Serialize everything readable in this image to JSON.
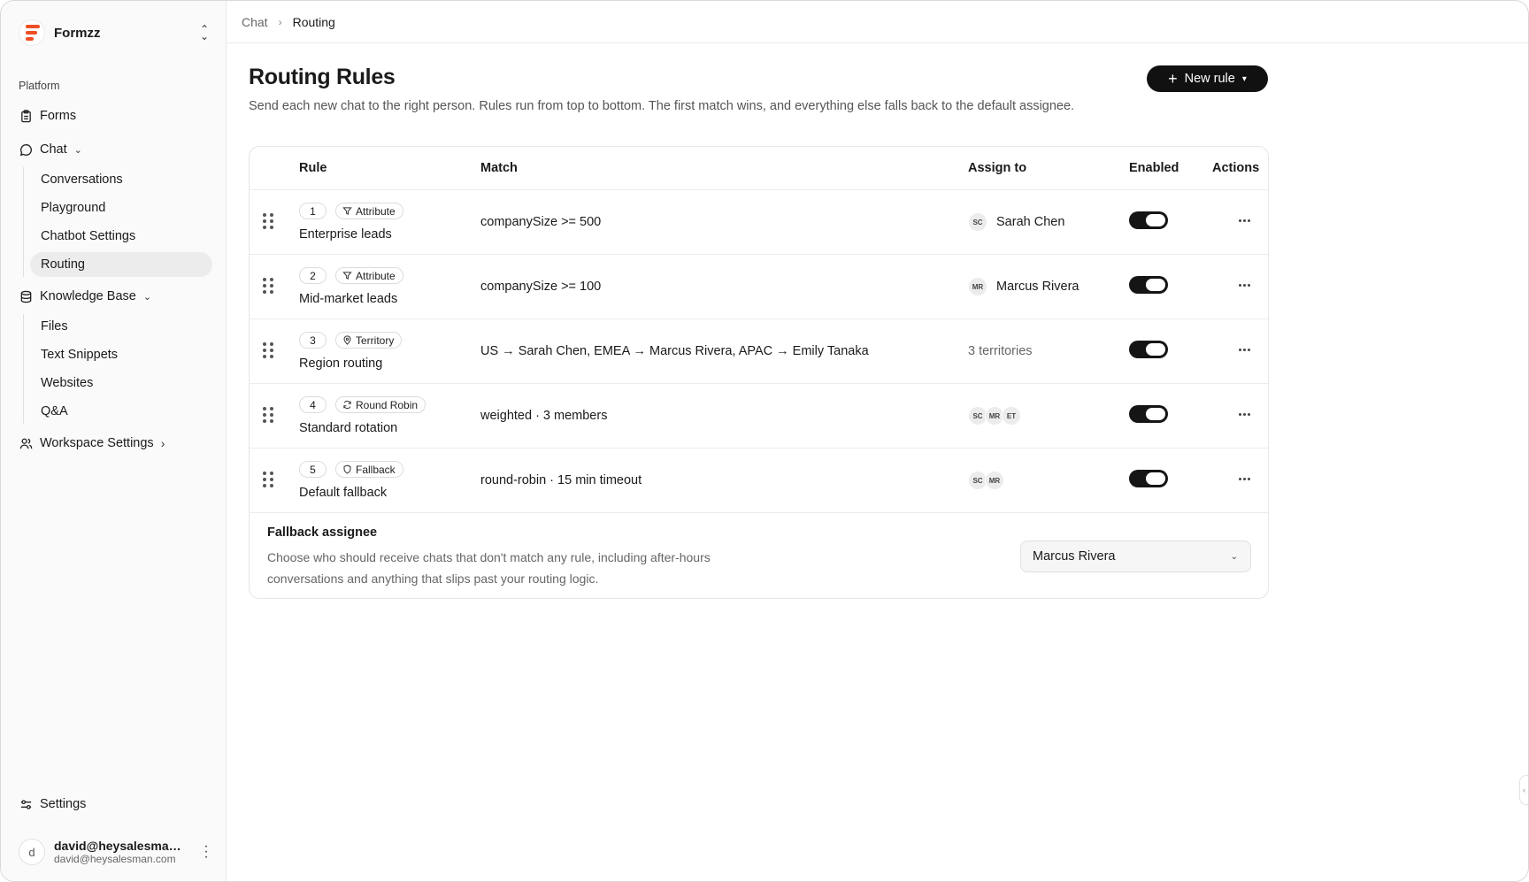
{
  "app": {
    "name": "Formzz",
    "brand_color": "#f04e23"
  },
  "sidebar": {
    "section_label": "Platform",
    "items": [
      {
        "label": "Forms",
        "icon": "clipboard-icon"
      },
      {
        "label": "Chat",
        "icon": "chat-bubble-icon",
        "expanded": true,
        "children": [
          "Conversations",
          "Playground",
          "Chatbot Settings",
          "Routing"
        ]
      },
      {
        "label": "Knowledge Base",
        "icon": "database-icon",
        "expanded": true,
        "children": [
          "Files",
          "Text Snippets",
          "Websites",
          "Q&A"
        ]
      },
      {
        "label": "Workspace Settings",
        "icon": "users-icon",
        "expanded": false
      }
    ],
    "active_item": "Routing",
    "settings_label": "Settings",
    "user": {
      "avatar_initial": "d",
      "name": "david@heysalesman.com",
      "email": "david@heysalesman.com"
    }
  },
  "breadcrumb": {
    "parent": "Chat",
    "current": "Routing"
  },
  "header": {
    "title": "Routing Rules",
    "subtitle": "Send each new chat to the right person. Rules run from top to bottom. The first match wins, and everything else falls back to the default assignee.",
    "new_rule_label": "New rule"
  },
  "table": {
    "columns": [
      "Rule",
      "Match",
      "Assign to",
      "Enabled",
      "Actions"
    ],
    "rows": [
      {
        "order": "1",
        "type": "Attribute",
        "type_icon": "filter-icon",
        "name": "Enterprise leads",
        "match": "companySize >= 500",
        "assignee_initials": [
          "SC"
        ],
        "assignee_name": "Sarah Chen",
        "enabled": true
      },
      {
        "order": "2",
        "type": "Attribute",
        "type_icon": "filter-icon",
        "name": "Mid-market leads",
        "match": "companySize >= 100",
        "assignee_initials": [
          "MR"
        ],
        "assignee_name": "Marcus Rivera",
        "enabled": true
      },
      {
        "order": "3",
        "type": "Territory",
        "type_icon": "map-pin-icon",
        "name": "Region routing",
        "match": "US → Sarah Chen, EMEA → Marcus Rivera, APAC → Emily Tanaka",
        "assignee_initials": [],
        "assignee_summary": "3 territories",
        "enabled": true
      },
      {
        "order": "4",
        "type": "Round Robin",
        "type_icon": "refresh-icon",
        "name": "Standard rotation",
        "match": "weighted · 3 members",
        "assignee_initials": [
          "SC",
          "MR",
          "ET"
        ],
        "enabled": true
      },
      {
        "order": "5",
        "type": "Fallback",
        "type_icon": "shield-icon",
        "name": "Default fallback",
        "match": "round-robin · 15 min timeout",
        "assignee_initials": [
          "SC",
          "MR"
        ],
        "enabled": true
      }
    ]
  },
  "fallback": {
    "title": "Fallback assignee",
    "description": "Choose who should receive chats that don't match any rule, including after-hours conversations and anything that slips past your routing logic.",
    "selected": "Marcus Rivera"
  }
}
